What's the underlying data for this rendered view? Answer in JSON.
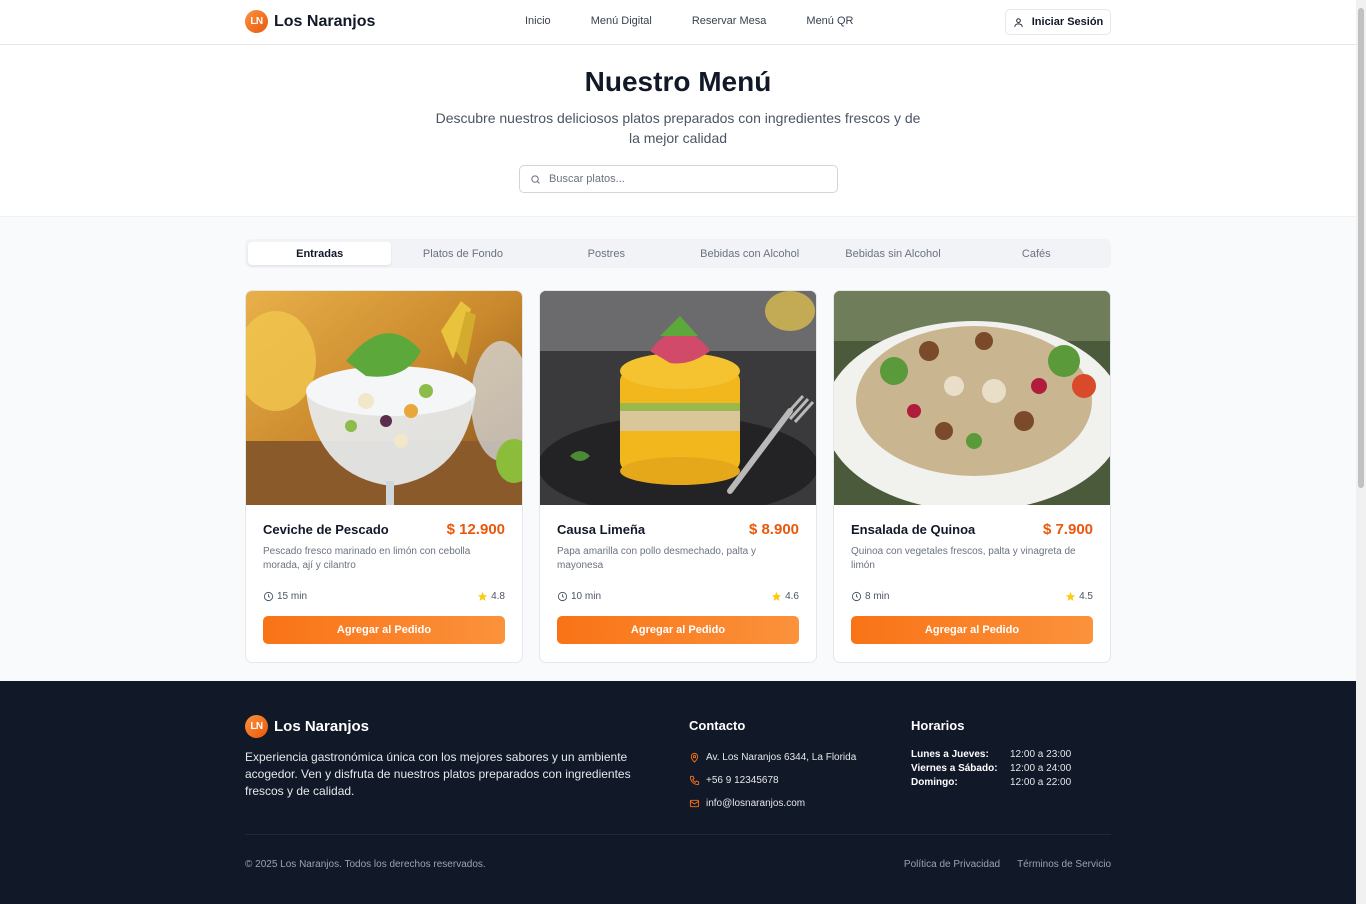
{
  "header": {
    "logo_initials": "LN",
    "brand": "Los Naranjos",
    "nav": [
      "Inicio",
      "Menú Digital",
      "Reservar Mesa",
      "Menú QR"
    ],
    "login_label": "Iniciar Sesión"
  },
  "hero": {
    "title": "Nuestro Menú",
    "subtitle": "Descubre nuestros deliciosos platos preparados con ingredientes frescos y de la mejor calidad",
    "search_placeholder": "Buscar platos..."
  },
  "tabs": [
    "Entradas",
    "Platos de Fondo",
    "Postres",
    "Bebidas con Alcohol",
    "Bebidas sin Alcohol",
    "Cafés"
  ],
  "active_tab": "Entradas",
  "dishes": [
    {
      "name": "Ceviche de Pescado",
      "price": "$ 12.900",
      "description": "Pescado fresco marinado en limón con cebolla morada, ají y cilantro",
      "time": "15 min",
      "rating": "4.8",
      "button": "Agregar al Pedido"
    },
    {
      "name": "Causa Limeña",
      "price": "$ 8.900",
      "description": "Papa amarilla con pollo desmechado, palta y mayonesa",
      "time": "10 min",
      "rating": "4.6",
      "button": "Agregar al Pedido"
    },
    {
      "name": "Ensalada de Quinoa",
      "price": "$ 7.900",
      "description": "Quinoa con vegetales frescos, palta y vinagreta de limón",
      "time": "8 min",
      "rating": "4.5",
      "button": "Agregar al Pedido"
    }
  ],
  "footer": {
    "brand": "Los Naranjos",
    "logo_initials": "LN",
    "description": "Experiencia gastronómica única con los mejores sabores y un ambiente acogedor. Ven y disfruta de nuestros platos preparados con ingredientes frescos y de calidad.",
    "contact_title": "Contacto",
    "address": "Av. Los Naranjos 6344, La Florida",
    "phone": "+56 9 12345678",
    "email": "info@losnaranjos.com",
    "hours_title": "Horarios",
    "hours": [
      {
        "day": "Lunes a Jueves:",
        "time": "12:00 a 23:00"
      },
      {
        "day": "Viernes a Sábado:",
        "time": "12:00 a 24:00"
      },
      {
        "day": "Domingo:",
        "time": "12:00 a 22:00"
      }
    ],
    "copyright": "© 2025 Los Naranjos. Todos los derechos reservados.",
    "privacy": "Política de Privacidad",
    "terms": "Términos de Servicio"
  },
  "colors": {
    "accent": "#f97316",
    "price": "#ea580c",
    "footer_bg": "#111827",
    "star": "#facc15"
  }
}
